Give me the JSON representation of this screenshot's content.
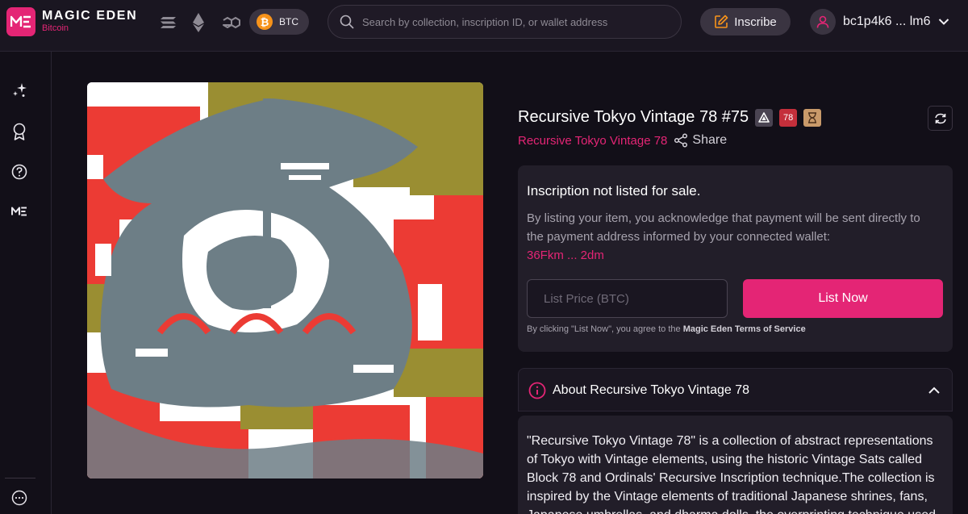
{
  "brand": {
    "name": "MAGIC EDEN",
    "sub": "Bitcoin"
  },
  "topbar": {
    "chain_label": "BTC",
    "search_placeholder": "Search by collection, inscription ID, or wallet address",
    "inscribe_label": "Inscribe",
    "wallet_address": "bc1p4k6 ... lm6"
  },
  "item": {
    "title": "Recursive Tokyo Vintage 78 #75",
    "collection": "Recursive Tokyo Vintage 78",
    "share_label": "Share",
    "badges": [
      "rare-sat-badge",
      "block-78-badge",
      "vintage-hourglass-badge"
    ],
    "badge_78_text": "78"
  },
  "listing": {
    "heading": "Inscription not listed for sale.",
    "description": "By listing your item, you acknowledge that payment will be sent directly to the payment address informed by your connected wallet:",
    "payment_address": "36Fkm ... 2dm",
    "price_placeholder": "List Price (BTC)",
    "list_button": "List Now",
    "terms_prefix": "By clicking \"List Now\", you agree to the ",
    "terms_link": "Magic Eden Terms of Service"
  },
  "about": {
    "title": "About Recursive Tokyo Vintage 78",
    "text": "\"Recursive Tokyo Vintage 78\" is a collection of abstract representations of Tokyo with Vintage elements, using the historic Vintage Sats called Block 78 and Ordinals' Recursive Inscription technique.The collection is inspired by the Vintage elements of traditional Japanese shrines, fans, Japanese umbrellas, and dharma dolls, the overprinting technique used"
  },
  "colors": {
    "accent": "#e42575",
    "bitcoin": "#f7931a",
    "background": "#120f18",
    "card": "#221e29",
    "art_red": "#ec3b34",
    "art_olive": "#9a8e32",
    "art_slate": "#6d7e86"
  }
}
